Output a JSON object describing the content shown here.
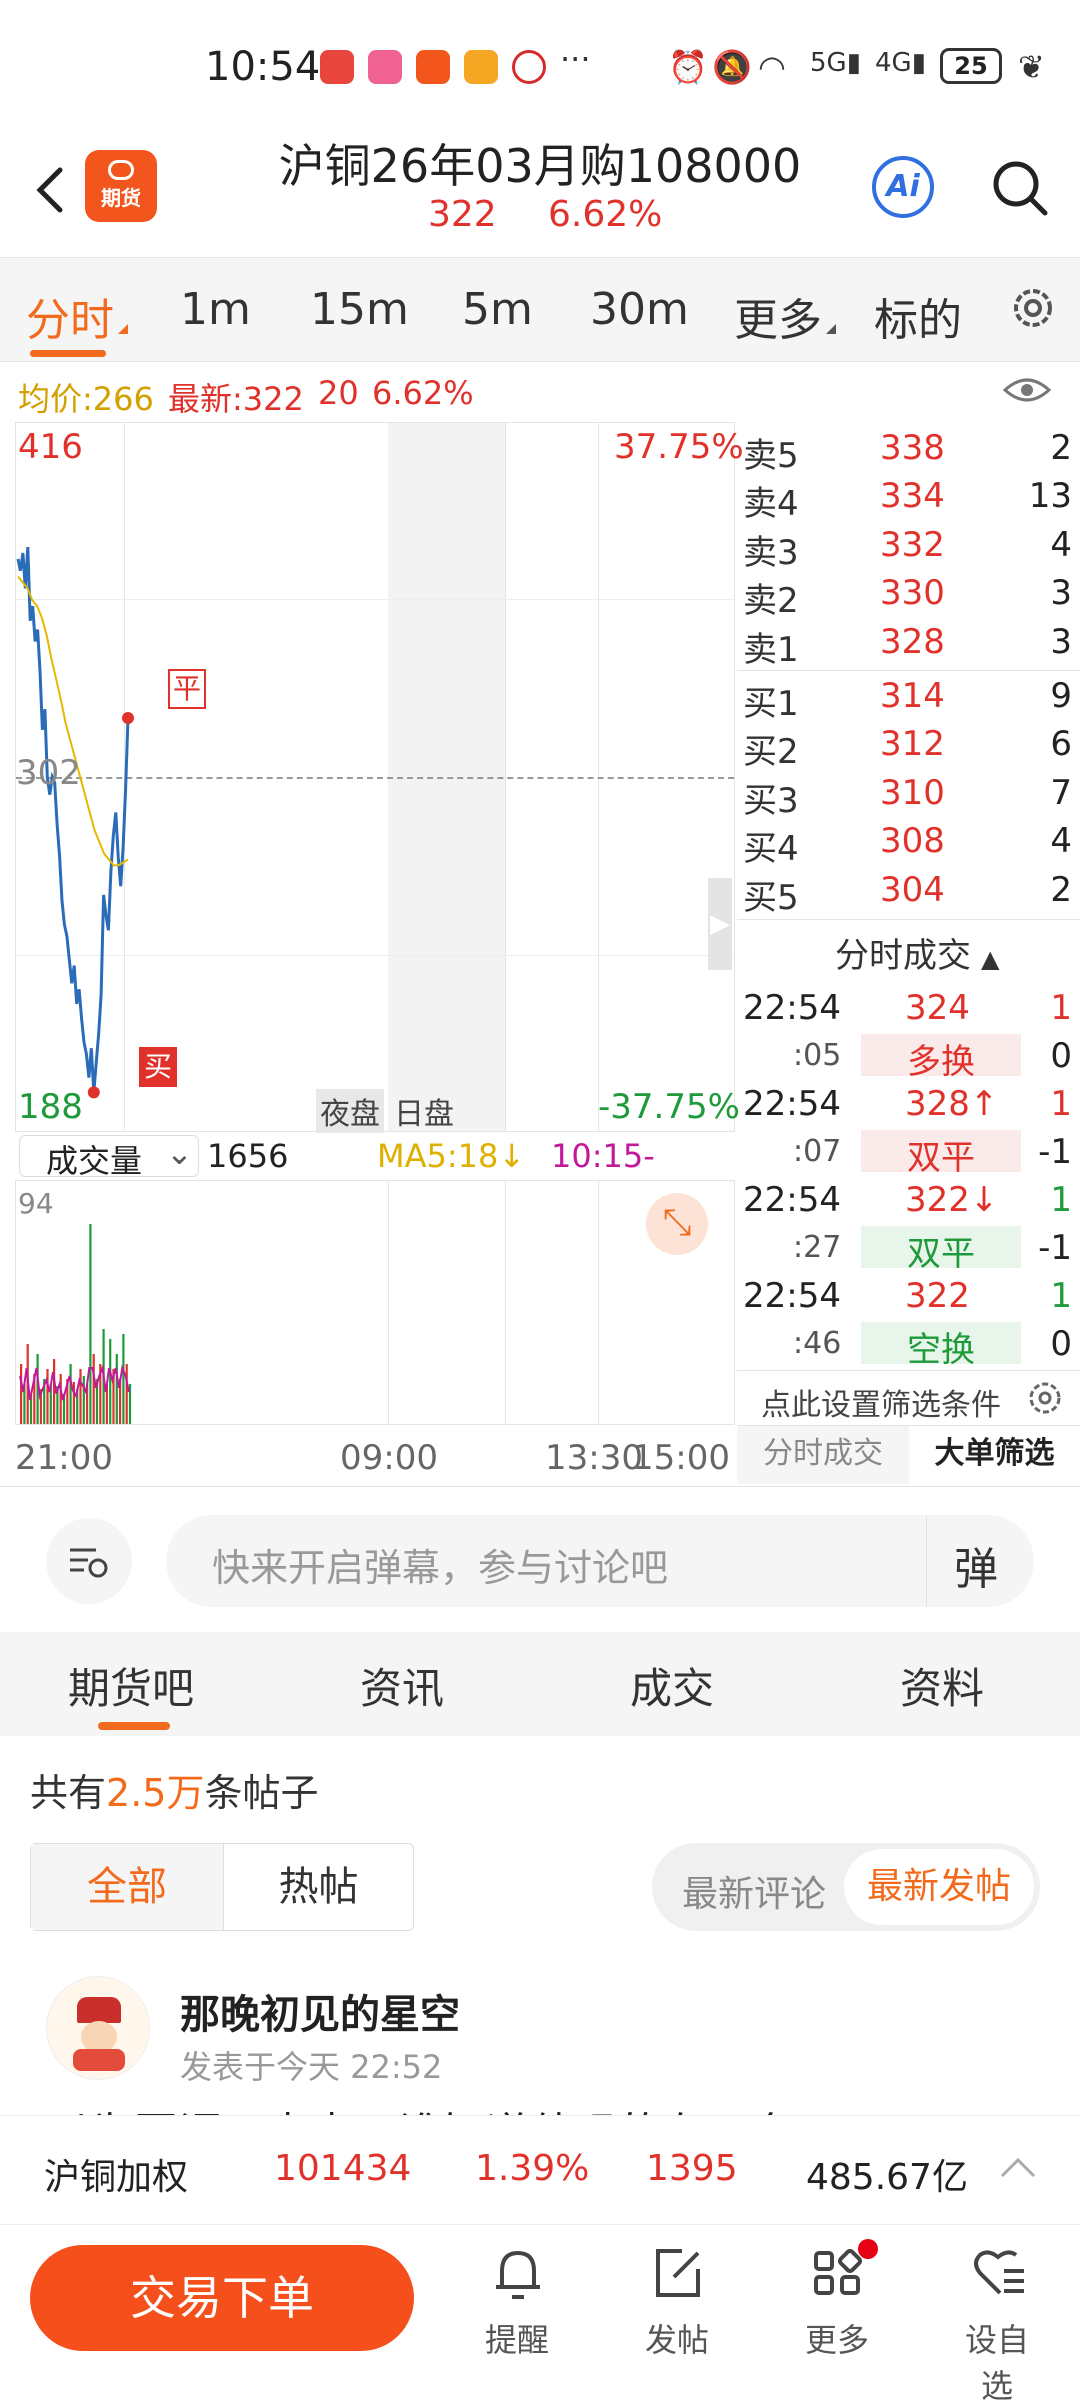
{
  "status_bar": {
    "time": "10:54",
    "dots": "···",
    "battery": "25"
  },
  "header": {
    "logo_text": "期货",
    "title": "沪铜26年03月购108000",
    "price": "322",
    "change_pct": "6.62%",
    "ai_label": "Ai"
  },
  "tabs": [
    "分时",
    "1m",
    "15m",
    "5m",
    "30m",
    "更多",
    "标的"
  ],
  "info_bar": {
    "avg": "均价:266",
    "latest": "最新:322",
    "change": "20",
    "pct": "6.62%"
  },
  "chart": {
    "y_max": "416",
    "y_min": "188",
    "y_mid": "302",
    "pct_max": "37.75%",
    "pct_min": "-37.75%",
    "night_label": "夜盘",
    "day_label": "日盘",
    "marker_close": "平",
    "marker_buy": "买",
    "volume_label": "成交量",
    "volume_value": "1656",
    "ma5": "MA5:18↓",
    "ma10": "10:15-",
    "vol_max": "94",
    "x_labels": [
      "21:00",
      "09:00",
      "13:30",
      "15:00"
    ]
  },
  "chart_data": {
    "type": "line",
    "ylim": [
      188,
      416
    ],
    "ref_price": 302,
    "series": [
      {
        "values": [
          376,
          372,
          378,
          366,
          380,
          355,
          360,
          348,
          352,
          338,
          318,
          325,
          302,
          296,
          302,
          300,
          286,
          275,
          260,
          252,
          248,
          240,
          232,
          238,
          225,
          230,
          220,
          212,
          208,
          200,
          210,
          195,
          205,
          215,
          228,
          262,
          255,
          250,
          270,
          282,
          290,
          275,
          265,
          278,
          298,
          322
        ]
      },
      {
        "values": [
          370,
          368,
          366,
          362,
          360,
          356,
          350,
          342,
          335,
          328,
          320,
          314,
          308,
          302,
          296,
          290,
          284,
          280,
          276,
          274,
          272,
          272,
          273,
          274
        ]
      }
    ]
  },
  "order_book": {
    "asks": [
      {
        "label": "卖5",
        "price": "338",
        "qty": "2"
      },
      {
        "label": "卖4",
        "price": "334",
        "qty": "13"
      },
      {
        "label": "卖3",
        "price": "332",
        "qty": "4"
      },
      {
        "label": "卖2",
        "price": "330",
        "qty": "3"
      },
      {
        "label": "卖1",
        "price": "328",
        "qty": "3"
      }
    ],
    "bids": [
      {
        "label": "买1",
        "price": "314",
        "qty": "9"
      },
      {
        "label": "买2",
        "price": "312",
        "qty": "6"
      },
      {
        "label": "买3",
        "price": "310",
        "qty": "7"
      },
      {
        "label": "买4",
        "price": "308",
        "qty": "4"
      },
      {
        "label": "买5",
        "price": "304",
        "qty": "2"
      }
    ]
  },
  "trades": {
    "header": "分时成交",
    "rows": [
      {
        "time": "22:54",
        "price": "324",
        "qty": "1",
        "sec": ":05",
        "type": "多换",
        "delta": "0",
        "color": "#e0322b"
      },
      {
        "time": "22:54",
        "price": "328↑",
        "qty": "1",
        "sec": ":07",
        "type": "双平",
        "delta": "-1",
        "color": "#e0322b"
      },
      {
        "time": "22:54",
        "price": "322↓",
        "qty": "1",
        "sec": ":27",
        "type": "双平",
        "delta": "-1",
        "color": "#1f9a3a"
      },
      {
        "time": "22:54",
        "price": "322",
        "qty": "1",
        "sec": ":46",
        "type": "空换",
        "delta": "0",
        "color": "#1f9a3a"
      }
    ],
    "filter_hint": "点此设置筛选条件",
    "bottom_tab_left": "分时成交",
    "bottom_tab_right": "大单筛选"
  },
  "comment": {
    "placeholder": "快来开启弹幕，参与讨论吧",
    "danmu": "弹"
  },
  "section_tabs": [
    "期货吧",
    "资讯",
    "成交",
    "资料"
  ],
  "posts": {
    "count_prefix": "共有",
    "count": "2.5万",
    "count_suffix": "条帖子",
    "filter_all": "全部",
    "filter_hot": "热帖",
    "sort_comment": "最新评论",
    "sort_post": "最新发帖",
    "author": "那晚初见的星空",
    "posted": "发表于今天 22:52",
    "preview": "以为回调一点点，谁知道他吗的在下套"
  },
  "market_bar": {
    "name": "沪铜加权",
    "price": "101434",
    "pct": "1.39%",
    "change": "1395",
    "amount": "485.67亿"
  },
  "bottom_nav": {
    "trade": "交易下单",
    "remind": "提醒",
    "post": "发帖",
    "more": "更多",
    "fav": "设自选"
  }
}
